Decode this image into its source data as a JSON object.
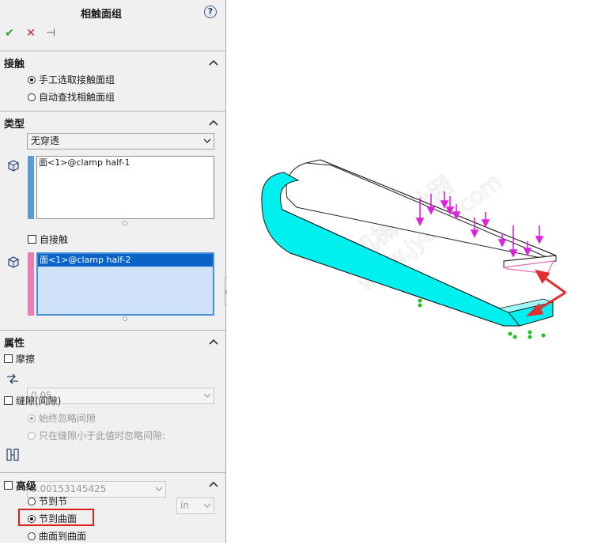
{
  "panel": {
    "title": "相触面组",
    "help_icon": "?"
  },
  "toolbar": {
    "ok": "✔",
    "cancel": "✕",
    "pin": "⊣"
  },
  "contact": {
    "title": "接触",
    "options": [
      {
        "label": "手工选取接触面组",
        "selected": true
      },
      {
        "label": "自动查找相触面组",
        "selected": false
      }
    ]
  },
  "type": {
    "title": "类型",
    "selected": "无穿透",
    "set1_color": "#5b9bd5",
    "set1_items": [
      "面<1>@clamp half-1"
    ],
    "self_contact_label": "自接触",
    "set2_color": "#f07ab4",
    "set2_items": [
      "面<1>@clamp half-2"
    ]
  },
  "properties": {
    "title": "属性",
    "friction_label": "摩擦",
    "friction_value": "0.05",
    "gap_label": "缝隙(间隙)",
    "gap_options": [
      {
        "label": "始终忽略间隙",
        "selected": true
      },
      {
        "label": "只在缝隙小于此值时忽略间隙:",
        "selected": false
      }
    ],
    "gap_value": "0.00153145425",
    "gap_unit": "in"
  },
  "advanced": {
    "title": "高级",
    "options": [
      {
        "label": "节到节",
        "selected": false
      },
      {
        "label": "节到曲面",
        "selected": true
      },
      {
        "label": "曲面到曲面",
        "selected": false
      }
    ]
  },
  "viewport": {
    "watermark_text": "机械设计网",
    "watermark_url": "www.jyage.com",
    "colors": {
      "face": "#00f0f0",
      "force_arrows": "#e020e0",
      "fixtures": "#20c020",
      "pointer": "#e03030"
    }
  }
}
